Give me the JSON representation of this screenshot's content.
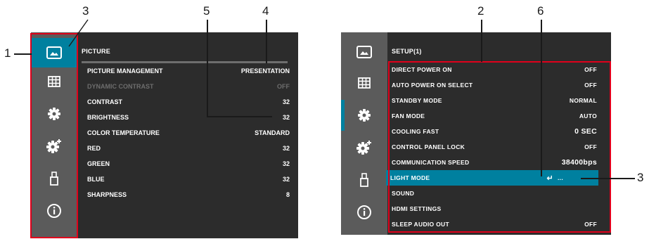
{
  "left": {
    "title": "PICTURE",
    "rows": [
      {
        "label": "PICTURE MANAGEMENT",
        "value": "PRESENTATION",
        "dim": false
      },
      {
        "label": "DYNAMIC CONTRAST",
        "value": "OFF",
        "dim": true
      },
      {
        "label": "CONTRAST",
        "value": "32",
        "dim": false
      },
      {
        "label": "BRIGHTNESS",
        "value": "32",
        "dim": false
      },
      {
        "label": "COLOR TEMPERATURE",
        "value": "STANDARD",
        "dim": false
      },
      {
        "label": "RED",
        "value": "32",
        "dim": false
      },
      {
        "label": "GREEN",
        "value": "32",
        "dim": false
      },
      {
        "label": "BLUE",
        "value": "32",
        "dim": false
      },
      {
        "label": "SHARPNESS",
        "value": "8",
        "dim": false
      }
    ]
  },
  "right": {
    "title": "SETUP(1)",
    "rows": [
      {
        "label": "DIRECT POWER ON",
        "value": "OFF"
      },
      {
        "label": "AUTO POWER ON SELECT",
        "value": "OFF"
      },
      {
        "label": "STANDBY MODE",
        "value": "NORMAL"
      },
      {
        "label": "FAN MODE",
        "value": "AUTO"
      },
      {
        "label": "COOLING FAST",
        "value": "0 SEC"
      },
      {
        "label": "CONTROL PANEL LOCK",
        "value": "OFF"
      },
      {
        "label": "COMMUNICATION SPEED",
        "value": "38400bps"
      },
      {
        "label": "LIGHT MODE",
        "value": "...",
        "selected": true
      },
      {
        "label": "SOUND",
        "value": ""
      },
      {
        "label": "HDMI SETTINGS",
        "value": ""
      },
      {
        "label": "SLEEP AUDIO OUT",
        "value": "OFF"
      }
    ],
    "enter_glyph": "↵"
  },
  "rail_icons": [
    "picture-icon",
    "grid-icon",
    "gear-icon",
    "gear-plus-icon",
    "usb-icon",
    "info-icon"
  ],
  "callouts": {
    "c1": "1",
    "c2": "2",
    "c3a": "3",
    "c3b": "3",
    "c4": "4",
    "c5": "5",
    "c6": "6"
  },
  "colors": {
    "accent": "#00809f",
    "panel": "#2c2c2c",
    "rail": "#5b5b5b",
    "highlight_box": "#e0001b"
  }
}
